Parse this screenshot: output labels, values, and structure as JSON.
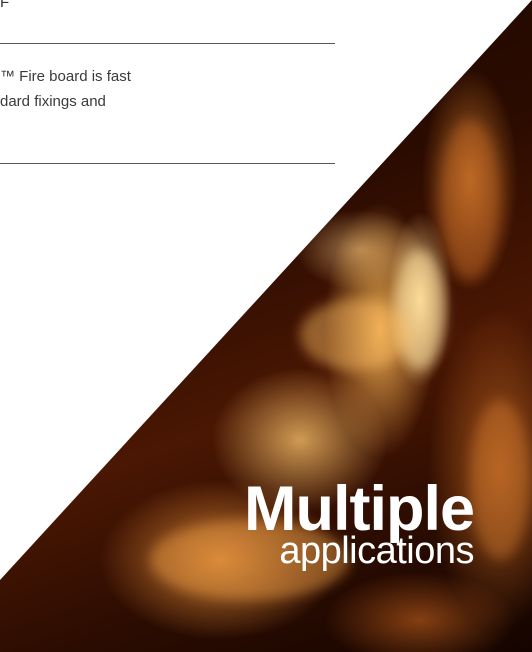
{
  "document": {
    "top_fragment": "F",
    "body_lines": [
      "™ Fire board is fast",
      "dard fixings and"
    ],
    "heading": {
      "main": "Multiple",
      "sub": "applications"
    }
  },
  "colors": {
    "rule": "#555555",
    "body_text": "#3a3a3a",
    "heading_text": "#ffffff",
    "fire_dark": "#1a0600",
    "fire_glow": "#ffb45a"
  }
}
